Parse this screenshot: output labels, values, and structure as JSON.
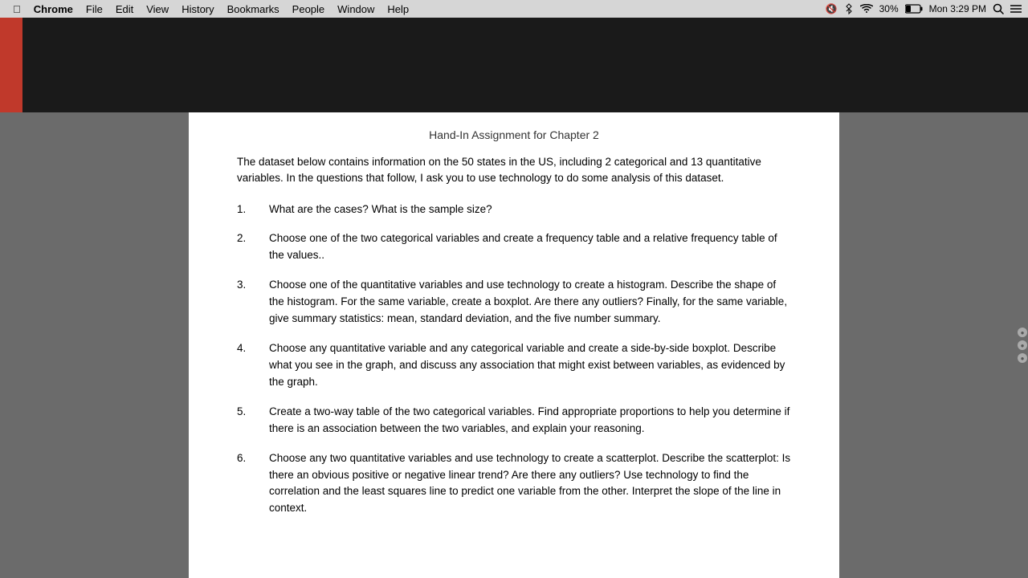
{
  "menubar": {
    "apple_symbol": "",
    "items": [
      {
        "label": "Chrome",
        "bold": true
      },
      {
        "label": "File"
      },
      {
        "label": "Edit"
      },
      {
        "label": "View"
      },
      {
        "label": "History"
      },
      {
        "label": "Bookmarks"
      },
      {
        "label": "People"
      },
      {
        "label": "Window"
      },
      {
        "label": "Help"
      }
    ],
    "right": {
      "volume": "🔇",
      "bluetooth": "",
      "wifi": "",
      "battery_percent": "30%",
      "datetime": "Mon 3:29 PM"
    }
  },
  "document": {
    "partial_heading": "Hand-In Assignment for Chapter 2",
    "intro": "The dataset below contains information on the 50 states in the US, including 2 categorical and 13 quantitative variables.  In the questions that follow, I ask you to use technology to do some analysis of this dataset.",
    "questions": [
      {
        "num": "1.",
        "text": "What are the cases?  What is the sample size?"
      },
      {
        "num": "2.",
        "text": "Choose one of the two categorical variables and create a frequency table and a relative frequency table of the values.."
      },
      {
        "num": "3.",
        "text": "Choose one of the quantitative variables and use technology to create a histogram.  Describe the shape of the histogram.  For the same variable, create a boxplot.  Are there any outliers?  Finally, for the same variable, give summary statistics: mean, standard deviation, and the five number summary."
      },
      {
        "num": "4.",
        "text": "Choose any quantitative variable and any categorical variable and create a side-by-side boxplot.  Describe what you see in the graph, and discuss any association that might exist between variables, as evidenced by the graph."
      },
      {
        "num": "5.",
        "text": "Create a two-way table of the two categorical variables.  Find appropriate proportions to help you determine if there is an association between the two variables, and explain your reasoning."
      },
      {
        "num": "6.",
        "text": "Choose any two quantitative variables and use technology to create a scatterplot.  Describe the scatterplot:  Is there an obvious positive or negative linear trend?  Are there any outliers?  Use technology to find the correlation and the least squares line to predict one variable from the other.  Interpret the slope of the line in context."
      }
    ]
  }
}
